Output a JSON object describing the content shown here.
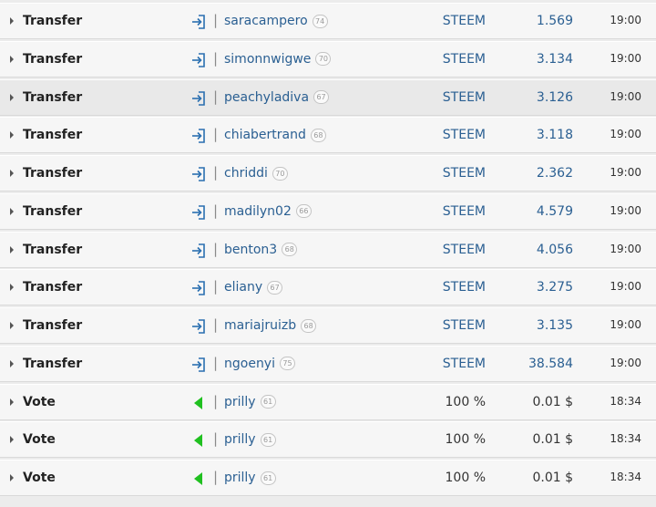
{
  "colors": {
    "link": "#2a5f92",
    "vote_icon": "#20c020",
    "transfer_icon": "#2a6fb0",
    "row_background": "#f6f6f6",
    "row_highlight": "#e9e9e9"
  },
  "operations": [
    {
      "type": "Transfer",
      "icon": "sign-in-icon",
      "account": "saracampero",
      "reputation": "74",
      "asset": "STEEM",
      "amount": "1.569",
      "time": "19:00"
    },
    {
      "type": "Transfer",
      "icon": "sign-in-icon",
      "account": "simonnwigwe",
      "reputation": "70",
      "asset": "STEEM",
      "amount": "3.134",
      "time": "19:00"
    },
    {
      "type": "Transfer",
      "icon": "sign-in-icon",
      "account": "peachyladiva",
      "reputation": "67",
      "asset": "STEEM",
      "amount": "3.126",
      "time": "19:00",
      "highlighted": true
    },
    {
      "type": "Transfer",
      "icon": "sign-in-icon",
      "account": "chiabertrand",
      "reputation": "68",
      "asset": "STEEM",
      "amount": "3.118",
      "time": "19:00"
    },
    {
      "type": "Transfer",
      "icon": "sign-in-icon",
      "account": "chriddi",
      "reputation": "70",
      "asset": "STEEM",
      "amount": "2.362",
      "time": "19:00"
    },
    {
      "type": "Transfer",
      "icon": "sign-in-icon",
      "account": "madilyn02",
      "reputation": "66",
      "asset": "STEEM",
      "amount": "4.579",
      "time": "19:00"
    },
    {
      "type": "Transfer",
      "icon": "sign-in-icon",
      "account": "benton3",
      "reputation": "68",
      "asset": "STEEM",
      "amount": "4.056",
      "time": "19:00"
    },
    {
      "type": "Transfer",
      "icon": "sign-in-icon",
      "account": "eliany",
      "reputation": "67",
      "asset": "STEEM",
      "amount": "3.275",
      "time": "19:00"
    },
    {
      "type": "Transfer",
      "icon": "sign-in-icon",
      "account": "mariajruizb",
      "reputation": "68",
      "asset": "STEEM",
      "amount": "3.135",
      "time": "19:00"
    },
    {
      "type": "Transfer",
      "icon": "sign-in-icon",
      "account": "ngoenyi",
      "reputation": "75",
      "asset": "STEEM",
      "amount": "38.584",
      "time": "19:00"
    },
    {
      "type": "Vote",
      "icon": "vote-triangle-icon",
      "account": "prilly",
      "reputation": "61",
      "asset": "100 %",
      "amount": "0.01 $",
      "time": "18:34"
    },
    {
      "type": "Vote",
      "icon": "vote-triangle-icon",
      "account": "prilly",
      "reputation": "61",
      "asset": "100 %",
      "amount": "0.01 $",
      "time": "18:34"
    },
    {
      "type": "Vote",
      "icon": "vote-triangle-icon",
      "account": "prilly",
      "reputation": "61",
      "asset": "100 %",
      "amount": "0.01 $",
      "time": "18:34"
    }
  ]
}
